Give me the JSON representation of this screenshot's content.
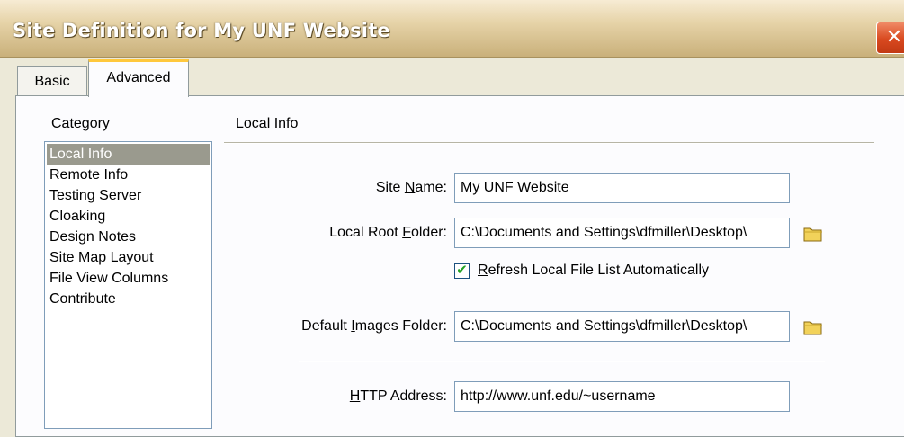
{
  "window": {
    "title": "Site Definition for My UNF Website",
    "close_glyph": "✕"
  },
  "tabs": [
    {
      "label": "Basic",
      "active": false
    },
    {
      "label": "Advanced",
      "active": true
    }
  ],
  "sidebar": {
    "heading": "Category",
    "items": [
      {
        "label": "Local Info",
        "selected": true
      },
      {
        "label": "Remote Info"
      },
      {
        "label": "Testing Server"
      },
      {
        "label": "Cloaking"
      },
      {
        "label": "Design Notes"
      },
      {
        "label": "Site Map Layout"
      },
      {
        "label": "File View Columns"
      },
      {
        "label": "Contribute"
      }
    ]
  },
  "main": {
    "section_title": "Local Info",
    "site_name": {
      "label_pre": "Site ",
      "label_u": "N",
      "label_post": "ame:",
      "value": "My UNF Website"
    },
    "local_root": {
      "label_pre": "Local Root ",
      "label_u": "F",
      "label_post": "older:",
      "value": "C:\\Documents and Settings\\dfmiller\\Desktop\\",
      "icon": "folder-icon"
    },
    "refresh": {
      "label_u": "R",
      "label_post": "efresh Local File List Automatically",
      "checked": true,
      "check_glyph": "✔"
    },
    "default_images": {
      "label_pre": "Default ",
      "label_u": "I",
      "label_post": "mages Folder:",
      "value": "C:\\Documents and Settings\\dfmiller\\Desktop\\",
      "icon": "folder-icon"
    },
    "http_address": {
      "label_pre": "",
      "label_u": "H",
      "label_post": "TTP Address:",
      "value": "http://www.unf.edu/~username"
    }
  },
  "colors": {
    "dialog_bg": "#ece9d8",
    "panel_bg": "#fcfcfe",
    "selected_item_bg": "#9a9a8e",
    "tab_accent": "#ffc83c",
    "close_red": "#d9491f",
    "folder_yellow": "#f2d25a"
  }
}
